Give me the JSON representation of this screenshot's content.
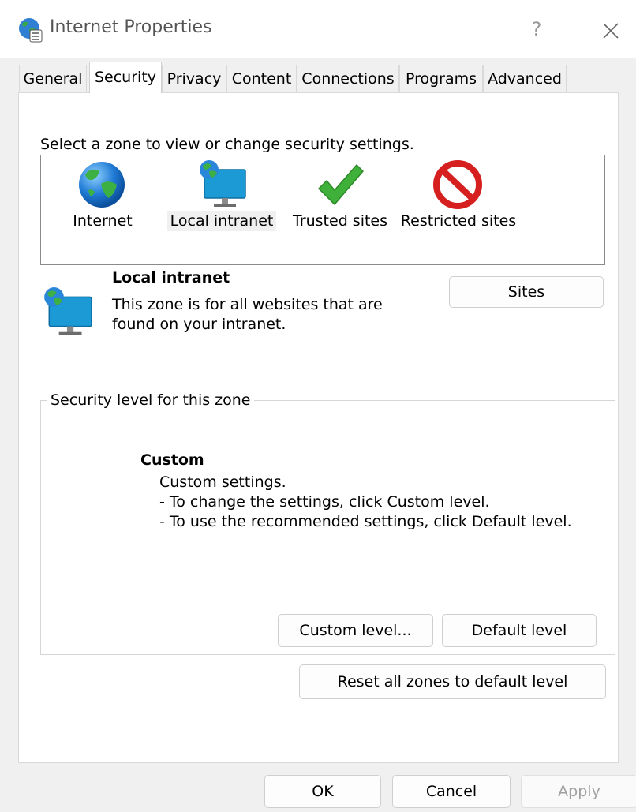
{
  "window": {
    "title": "Internet Properties",
    "help_label": "?",
    "colors": {
      "chrome": "#f0f0f0",
      "titlebar": "#ffffff",
      "border": "#d9d9d9"
    }
  },
  "tabs": [
    {
      "label": "General"
    },
    {
      "label": "Security",
      "active": true
    },
    {
      "label": "Privacy"
    },
    {
      "label": "Content"
    },
    {
      "label": "Connections"
    },
    {
      "label": "Programs"
    },
    {
      "label": "Advanced"
    }
  ],
  "security": {
    "zone_prompt": "Select a zone to view or change security settings.",
    "zones": [
      {
        "label": "Internet",
        "icon": "globe-icon"
      },
      {
        "label": "Local intranet",
        "icon": "intranet-monitor-icon",
        "selected": true
      },
      {
        "label": "Trusted sites",
        "icon": "checkmark-icon"
      },
      {
        "label": "Restricted sites",
        "icon": "no-entry-icon"
      }
    ],
    "selected_zone": {
      "name": "Local intranet",
      "description_line1": "This zone is for all websites that are",
      "description_line2": "found on your intranet.",
      "sites_button": "Sites"
    },
    "level_group": {
      "legend": "Security level for this zone",
      "level_name": "Custom",
      "lines": [
        "Custom settings.",
        "- To change the settings, click Custom level.",
        "- To use the recommended settings, click Default level."
      ],
      "custom_button": "Custom level...",
      "default_button": "Default level"
    },
    "reset_button": "Reset all zones to default level"
  },
  "footer": {
    "ok": "OK",
    "cancel": "Cancel",
    "apply": "Apply"
  }
}
